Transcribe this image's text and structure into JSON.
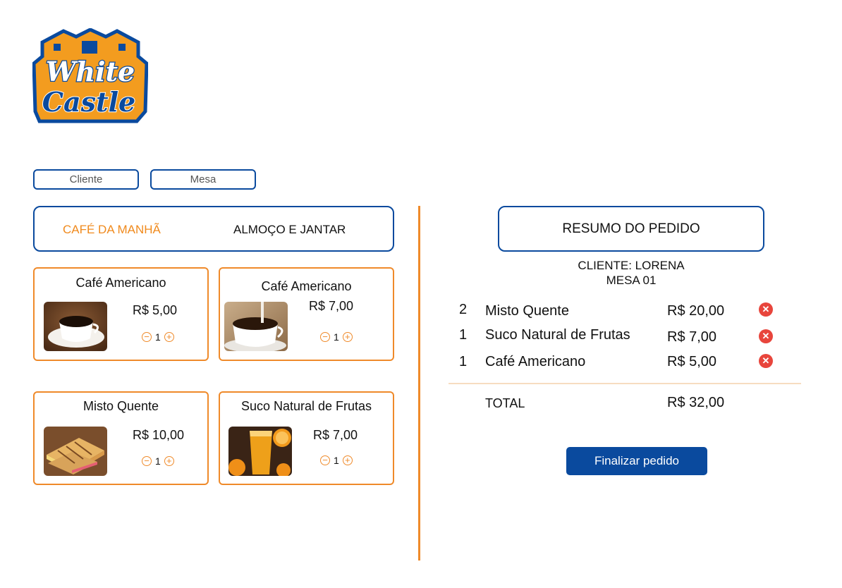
{
  "brand": {
    "logo_line1": "White",
    "logo_line2": "Castle",
    "logo_blue": "#0a4a9e",
    "logo_orange": "#f39c1f"
  },
  "form": {
    "cliente": {
      "placeholder": "Cliente",
      "value": ""
    },
    "mesa": {
      "placeholder": "Mesa",
      "value": ""
    }
  },
  "tabs": [
    {
      "label": "CAFÉ DA MANHÃ",
      "active": true
    },
    {
      "label": "ALMOÇO E JANTAR",
      "active": false
    }
  ],
  "products": [
    {
      "name": "Café Americano",
      "price": "R$ 5,00",
      "qty": "1",
      "image": "coffee-cup"
    },
    {
      "name": "Café Americano",
      "price": "R$ 7,00",
      "qty": "1",
      "image": "coffee-pour"
    },
    {
      "name": "Misto Quente",
      "price": "R$ 10,00",
      "qty": "1",
      "image": "grilled-sandwich"
    },
    {
      "name": "Suco Natural de Frutas",
      "price": "R$ 7,00",
      "qty": "1",
      "image": "orange-juice"
    }
  ],
  "summary": {
    "title": "RESUMO DO PEDIDO",
    "cliente": "CLIENTE: LORENA",
    "mesa": "MESA 01",
    "items": [
      {
        "qty": "2",
        "name": "Misto Quente",
        "price": "R$ 20,00"
      },
      {
        "qty": "1",
        "name": "Suco Natural de Frutas",
        "price": "R$ 7,00"
      },
      {
        "qty": "1",
        "name": "Café Americano",
        "price": "R$ 5,00"
      }
    ],
    "total_label": "TOTAL",
    "total_value": "R$ 32,00",
    "finalize_label": "Finalizar pedido"
  },
  "colors": {
    "accent": "#ef8a2a",
    "primary": "#0a4a9e",
    "delete": "#e8453c",
    "active_tab": "#f08a1d"
  }
}
